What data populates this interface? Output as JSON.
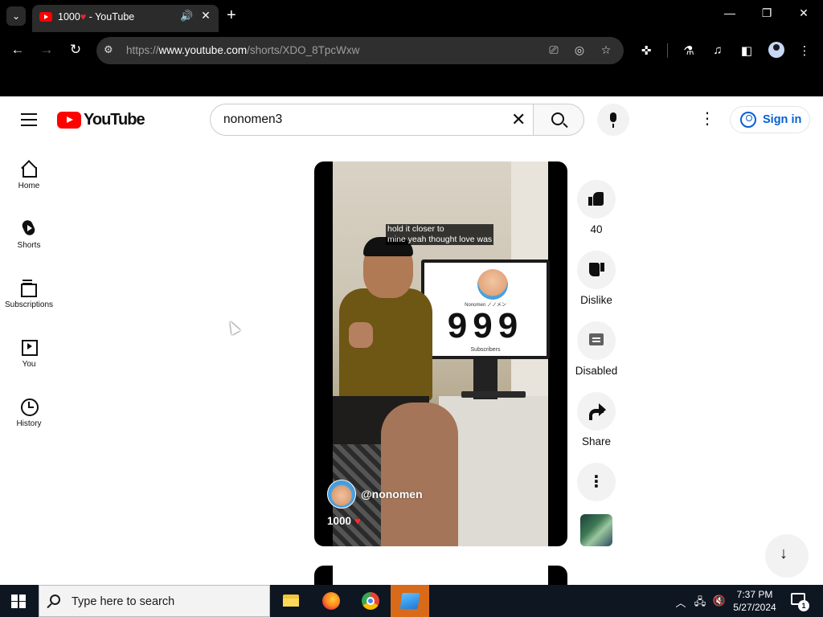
{
  "browser": {
    "tab": {
      "title": "1000",
      "title_heart": "♥",
      "title_suffix": " - YouTube",
      "audio_icon": "speaker-icon",
      "close_glyph": "✕"
    },
    "new_tab_glyph": "+",
    "window_controls": {
      "minimize": "—",
      "restore": "❐",
      "close": "✕"
    },
    "address": {
      "scheme": "https://",
      "domain": "www.youtube.com",
      "path": "/shorts/XDO_8TpcWxw"
    },
    "nav": {
      "back": "←",
      "forward": "→",
      "reload": "↻"
    },
    "toolbar_icons": [
      "cast-icon",
      "eye-off-icon",
      "star-icon",
      "extensions-icon",
      "labs-icon",
      "media-icon",
      "side-panel-icon",
      "profile-icon",
      "menu-icon"
    ]
  },
  "youtube": {
    "logo_text": "YouTube",
    "search": {
      "value": "nonomen3",
      "clear_glyph": "✕"
    },
    "more_glyph": "⋮",
    "sign_in": "Sign in",
    "guide": [
      {
        "label": "Home",
        "icon": "home-icon"
      },
      {
        "label": "Shorts",
        "icon": "shorts-icon"
      },
      {
        "label": "Subscriptions",
        "icon": "subscriptions-icon"
      },
      {
        "label": "You",
        "icon": "you-icon"
      },
      {
        "label": "History",
        "icon": "history-icon"
      }
    ],
    "short": {
      "caption_line1": "hold it closer to",
      "caption_line2": "mine yeah thought love was",
      "monitor_name": "Nonomen ノノメン",
      "monitor_count": "999",
      "monitor_sub": "Subscribers",
      "channel_handle": "@nonomen",
      "title": "1000",
      "title_heart": "♥"
    },
    "actions": {
      "like_count": "40",
      "dislike_label": "Dislike",
      "comments_label": "Disabled",
      "share_label": "Share",
      "more_glyph": "⋮"
    },
    "scroll_down_glyph": "↓"
  },
  "taskbar": {
    "search_placeholder": "Type here to search",
    "apps": [
      "file-explorer-icon",
      "firefox-icon",
      "chrome-icon",
      "app-icon"
    ],
    "time": "7:37 PM",
    "date": "5/27/2024",
    "notification_count": "1"
  }
}
